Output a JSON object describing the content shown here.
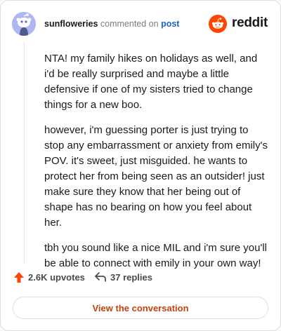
{
  "comment": {
    "username": "sunfloweries",
    "action_text": "commented on",
    "target_link": "post",
    "paragraphs": [
      "NTA! my family hikes on holidays as well, and i'd be really surprised and maybe a little defensive if one of my sisters tried to change things for a new boo.",
      "however, i'm guessing porter is just trying to stop any embarrassment or anxiety from emily's POV. it's sweet, just misguided. he wants to protect her from being seen as an outsider! just make sure they know that her being out of shape has no bearing on how you feel about her.",
      "tbh you sound like a nice MIL and i'm sure you'll be able to connect with emily in your own way!"
    ]
  },
  "brand": {
    "name": "reddit",
    "color": "#ff4500"
  },
  "actions": {
    "upvotes_label": "2.6K upvotes",
    "replies_label": "37 replies",
    "upvote_color": "#ff4500"
  },
  "cta": {
    "label": "View the conversation"
  },
  "icons": {
    "avatar": "snoo-avatar-icon",
    "brand": "reddit-logo-icon",
    "upvote": "upvote-arrow-icon",
    "reply": "reply-arrow-icon"
  }
}
